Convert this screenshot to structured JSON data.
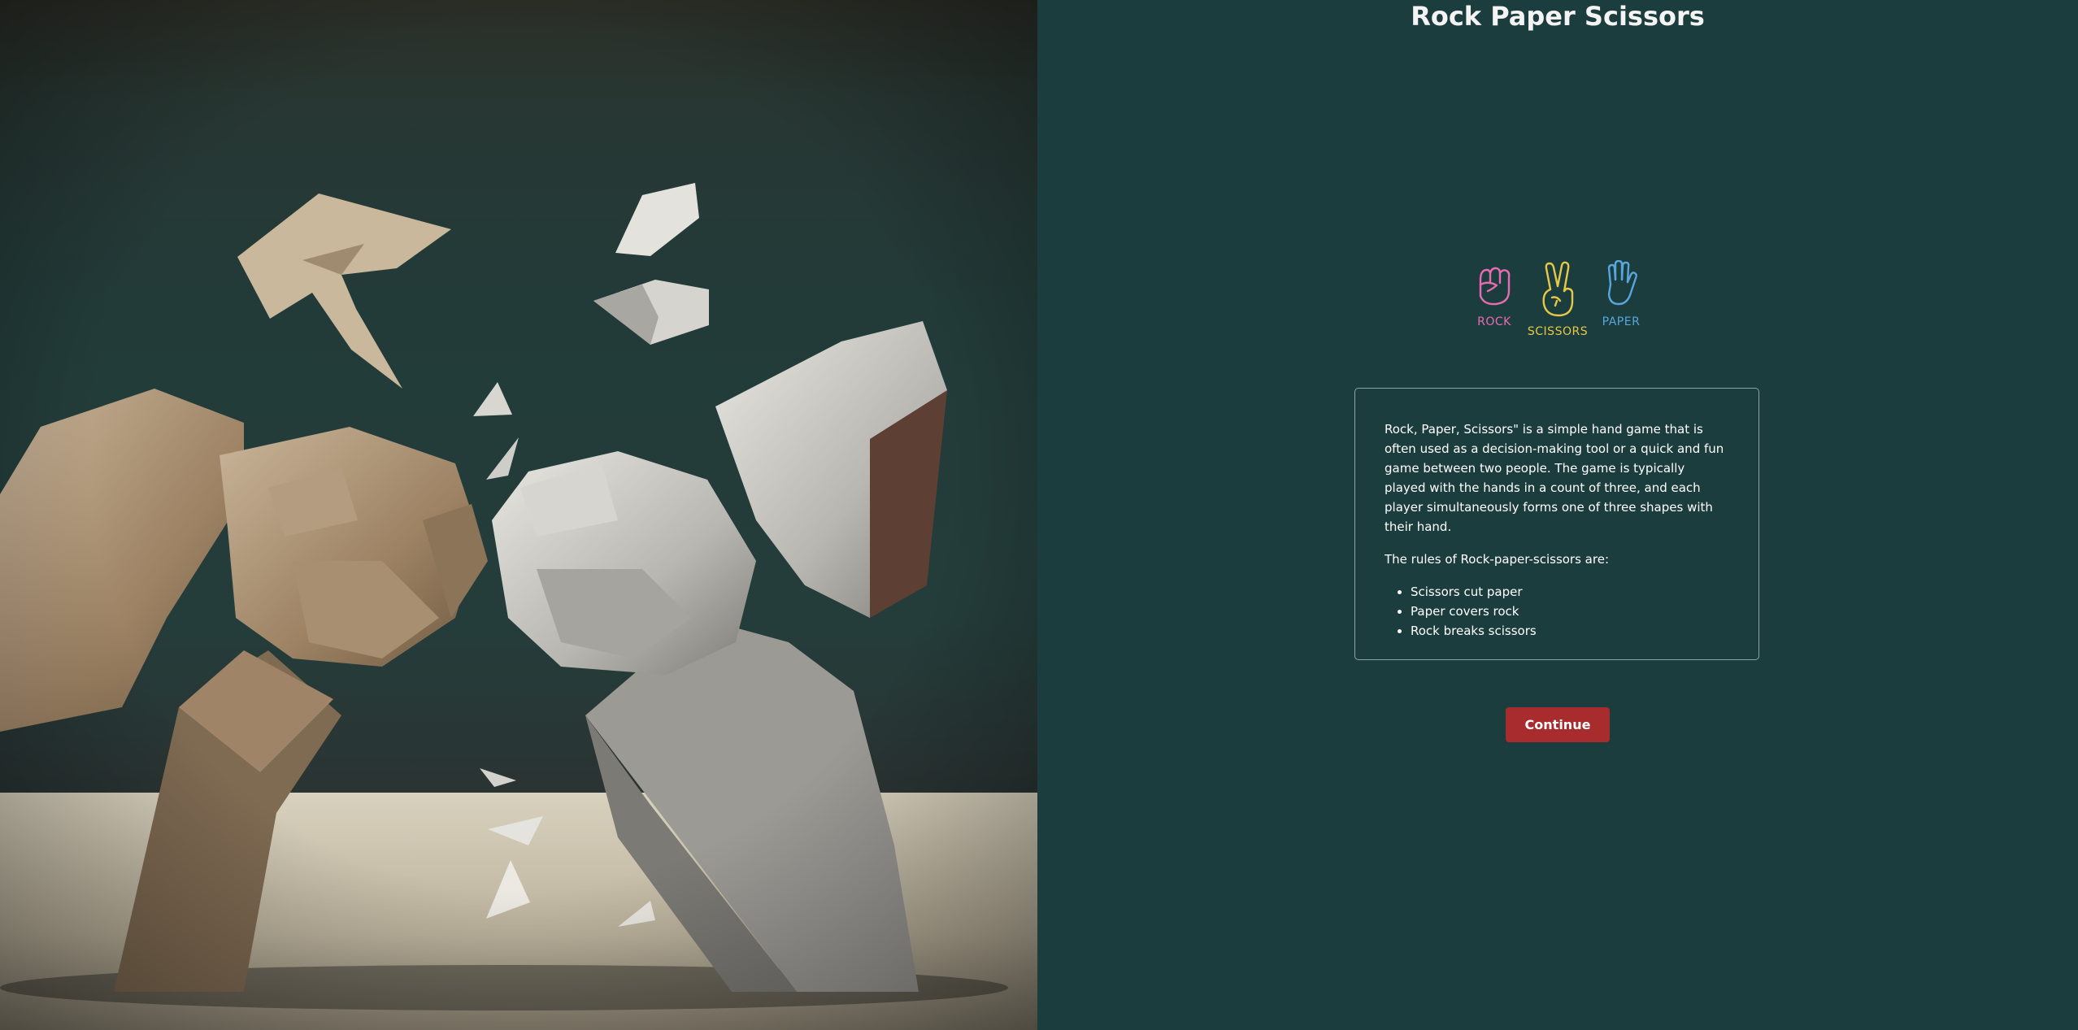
{
  "page": {
    "title": "Rock Paper Scissors"
  },
  "hero": {
    "alt": "Origami rock paper scissors illustration"
  },
  "choices": [
    {
      "label": "ROCK",
      "icon": "fist-icon",
      "color": "#e96bb0"
    },
    {
      "label": "SCISSORS",
      "icon": "peace-hand-icon",
      "color": "#e7c846"
    },
    {
      "label": "PAPER",
      "icon": "open-hand-icon",
      "color": "#58a6dc"
    }
  ],
  "rules": {
    "intro": "Rock, Paper, Scissors\" is a simple hand game that is often used as a decision-making tool or a quick and fun game between two people. The game is typically played with the hands in a count of three, and each player simultaneously forms one of three shapes with their hand.",
    "heading": "The rules of Rock-paper-scissors are:",
    "items": [
      "Scissors cut paper",
      "Paper covers rock",
      "Rock breaks scissors"
    ]
  },
  "actions": {
    "continue_label": "Continue"
  },
  "colors": {
    "panel_bg": "#1c3d3e",
    "button_bg": "#a82c2e"
  }
}
